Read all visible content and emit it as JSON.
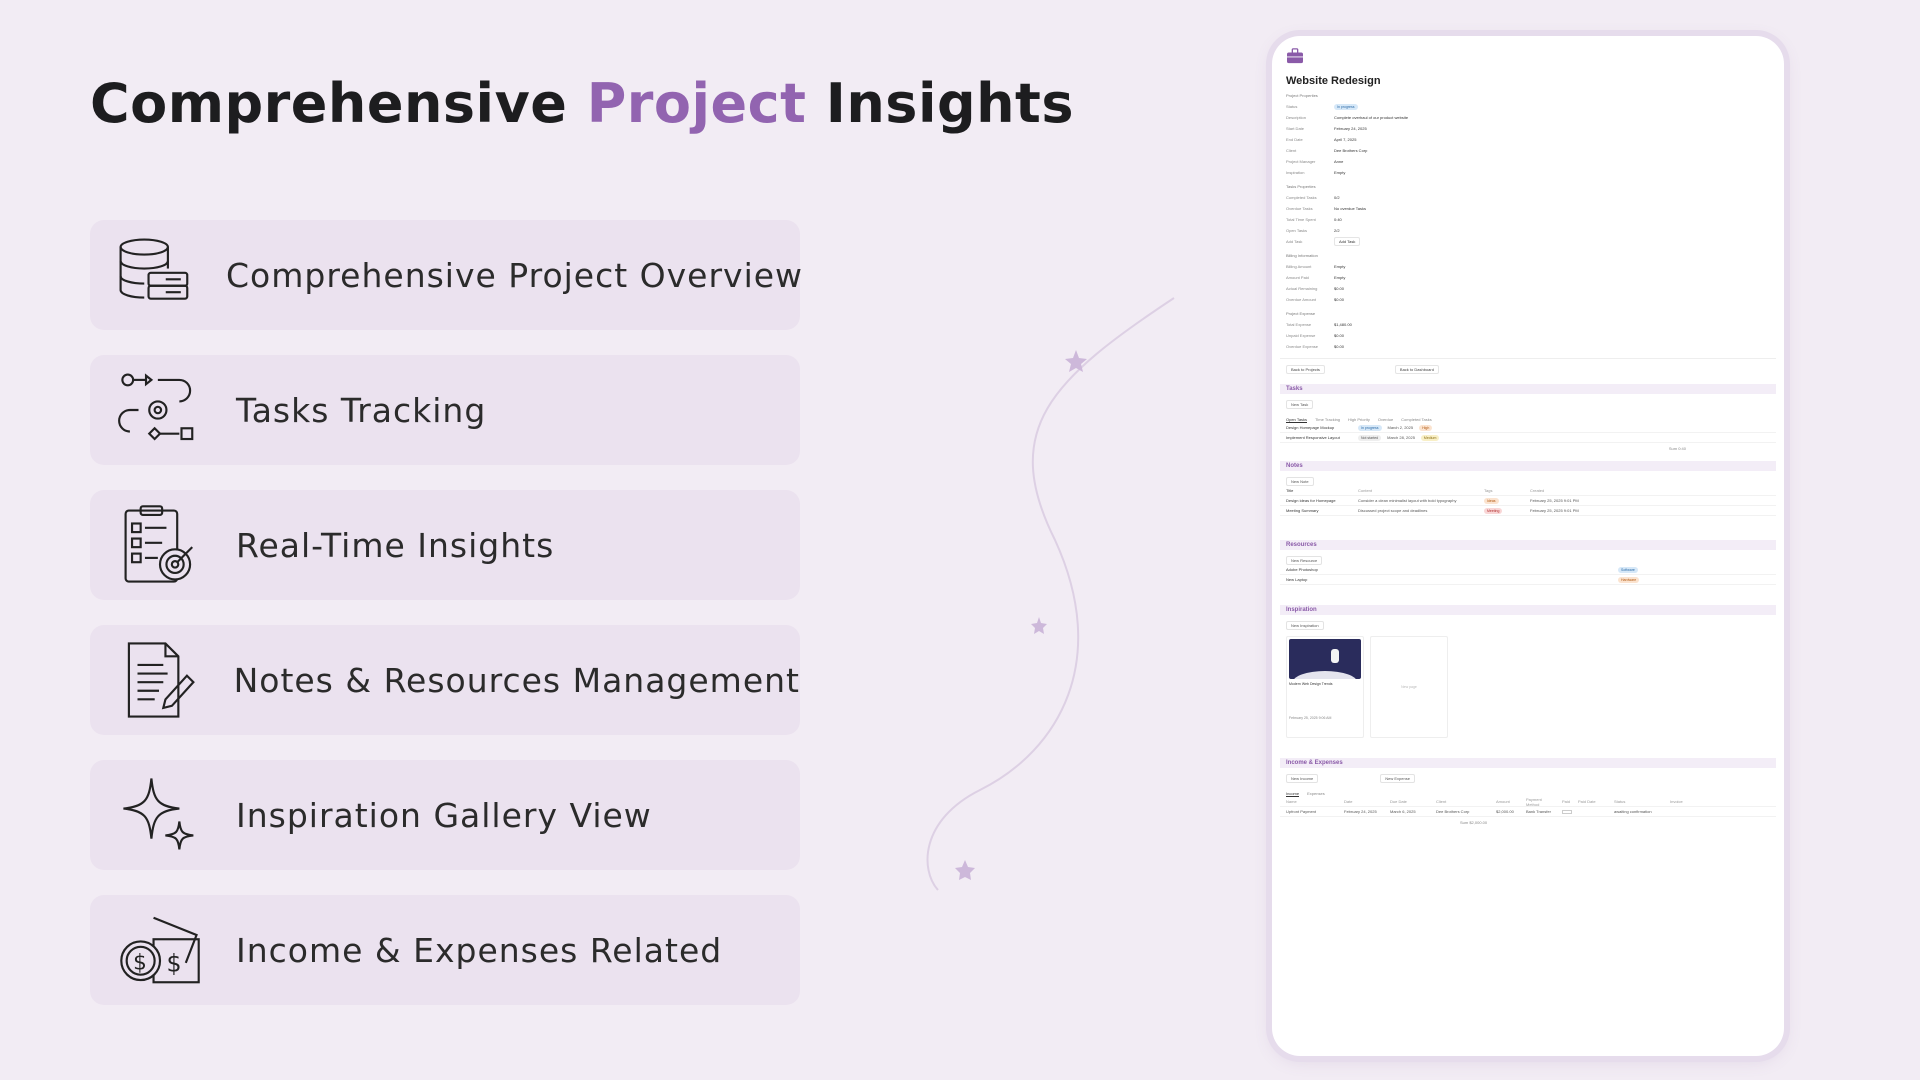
{
  "headline": {
    "part1": "Comprehensive ",
    "accent": "Project",
    "part2": " Insights"
  },
  "features": [
    {
      "label": "Comprehensive Project Overview",
      "icon": "database-icon"
    },
    {
      "label": "Tasks Tracking",
      "icon": "workflow-gear-icon"
    },
    {
      "label": "Real-Time Insights",
      "icon": "clipboard-target-icon"
    },
    {
      "label": "Notes & Resources Management",
      "icon": "document-pen-icon"
    },
    {
      "label": "Inspiration Gallery View",
      "icon": "sparkle-icon"
    },
    {
      "label": "Income & Expenses Related",
      "icon": "money-icon"
    }
  ],
  "colors": {
    "accent": "#9264b0",
    "background": "#f2ecf4",
    "card": "#ebe2ef"
  },
  "doc": {
    "title": "Website Redesign",
    "props_header": "Project Properties",
    "props": [
      {
        "k": "Status",
        "v": "In progress",
        "pill": "blue"
      },
      {
        "k": "Description",
        "v": "Complete overhaul of our product website"
      },
      {
        "k": "Start Date",
        "v": "February 24, 2025"
      },
      {
        "k": "End Date",
        "v": "April 7, 2025"
      },
      {
        "k": "Client",
        "v": "Dee Brothers Corp"
      },
      {
        "k": "Project Manager",
        "v": "Anne"
      },
      {
        "k": "Inspiration",
        "v": "Empty"
      }
    ],
    "tasks_header": "Tasks Properties",
    "tasks_props": [
      {
        "k": "Completed Tasks",
        "v": "0/2"
      },
      {
        "k": "Overdue Tasks",
        "v": "No overdue Tasks"
      },
      {
        "k": "Total Time Spent",
        "v": "0:40"
      },
      {
        "k": "Open Tasks",
        "v": "2/2"
      },
      {
        "k": "Add Task",
        "v": "Add Task"
      }
    ],
    "billing_header": "Billing Information",
    "billing_props": [
      {
        "k": "Billing Amount",
        "v": "Empty"
      },
      {
        "k": "Amount Paid",
        "v": "Empty"
      },
      {
        "k": "Actual Remaining",
        "v": "$0.00"
      },
      {
        "k": "Overdue Amount",
        "v": "$0.00"
      }
    ],
    "expense_header": "Project Expense",
    "expense_props": [
      {
        "k": "Total Expense",
        "v": "$1,480.00"
      },
      {
        "k": "Unpaid Expense",
        "v": "$0.00"
      },
      {
        "k": "Overdue Expense",
        "v": "$0.00"
      }
    ],
    "back_projects": "Back to Projects",
    "back_dashboard": "Back to Dashboard",
    "tasks_section": "Tasks",
    "new_task": "New Task",
    "task_tabs": [
      "Open Tasks",
      "Time Tracking",
      "High Priority",
      "Overdue",
      "Completed Tasks"
    ],
    "tasks": [
      {
        "name": "Design Homepage Mockup",
        "status": "In progress",
        "date": "March 2, 2025",
        "priority": "High"
      },
      {
        "name": "Implement Responsive Layout",
        "status": "Not started",
        "date": "March 28, 2025",
        "priority": "Medium"
      }
    ],
    "task_sum": "Sum 0:40",
    "notes_section": "Notes",
    "new_note": "New Note",
    "notes_cols": [
      "Title",
      "Content",
      "Tags",
      "Created"
    ],
    "notes": [
      {
        "title": "Design ideas for Homepage",
        "content": "Consider a clean minimalist layout with bold typography",
        "tag": "Ideas",
        "created": "February 25, 2025 9:01 PM"
      },
      {
        "title": "Meeting Summary",
        "content": "Discussed project scope and deadlines",
        "tag": "Meeting",
        "created": "February 25, 2025 9:01 PM"
      }
    ],
    "resources_section": "Resources",
    "new_resource": "New Resource",
    "resources": [
      {
        "name": "Adobe Photoshop",
        "tag": "Software"
      },
      {
        "name": "New Laptop",
        "tag": "Hardware"
      }
    ],
    "inspiration_section": "Inspiration",
    "new_inspiration": "New Inspiration",
    "inspo_card": {
      "title": "Modern Web Design Trends",
      "date": "February 25, 2025 9:06 AM"
    },
    "new_page": "New page",
    "income_section": "Income & Expenses",
    "new_income": "New Income",
    "new_expense": "New Expense",
    "income_tabs": [
      "Income",
      "Expenses"
    ],
    "income_cols": [
      "Name",
      "Date",
      "Due Date",
      "Client",
      "Amount",
      "Payment Method",
      "Paid",
      "Paid Date",
      "Status",
      "Invoice"
    ],
    "income_row": {
      "name": "Upfront Payment",
      "date": "February 24, 2025",
      "due": "March 6, 2025",
      "client": "Dee Brothers Corp",
      "amount": "$2,000.00",
      "method": "Bank Transfer",
      "status": "awaiting confirmation"
    },
    "income_sum": "Sum $2,000.00"
  }
}
